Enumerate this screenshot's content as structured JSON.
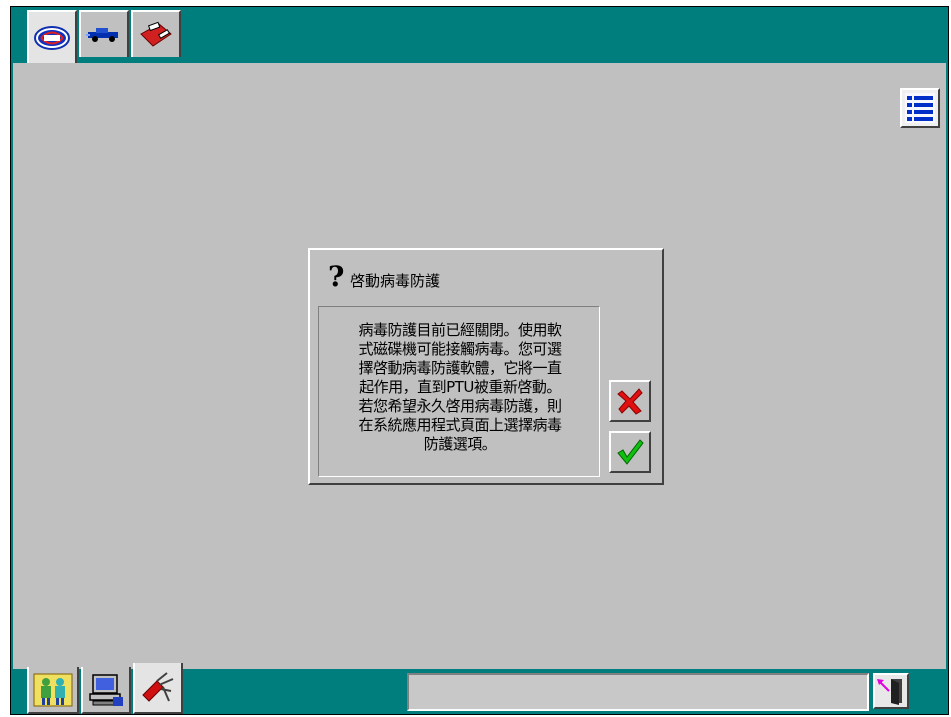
{
  "app": {
    "top_tabs": [
      {
        "icon": "vds-logo-icon",
        "active": true
      },
      {
        "icon": "vehicle-icon",
        "active": false
      },
      {
        "icon": "toolbox-icon",
        "active": false
      }
    ],
    "list_button_icon": "list-icon"
  },
  "dialog": {
    "icon": "question-icon",
    "question_mark": "?",
    "title": "啓動病毒防護",
    "message": "病毒防護目前已經關閉。使用軟\n式磁碟機可能接觸病毒。您可選\n擇啓動病毒防護軟體，它將一直\n起作用，直到PTU被重新啓動。\n若您希望永久啓用病毒防護，則\n在系統應用程式頁面上選擇病毒\n防護選項。",
    "cancel_icon": "red-x-icon",
    "ok_icon": "green-check-icon"
  },
  "bottom_bar": {
    "tabs": [
      {
        "icon": "users-icon",
        "active": false
      },
      {
        "icon": "computer-icon",
        "active": false
      },
      {
        "icon": "multitool-icon",
        "active": true
      }
    ],
    "status_text": "",
    "exit_icon": "exit-door-icon"
  },
  "colors": {
    "frame": "#007e7e",
    "panel": "#c0c0c0",
    "cancel": "#e01010",
    "ok": "#10c010",
    "list_icon": "#0030c8"
  }
}
